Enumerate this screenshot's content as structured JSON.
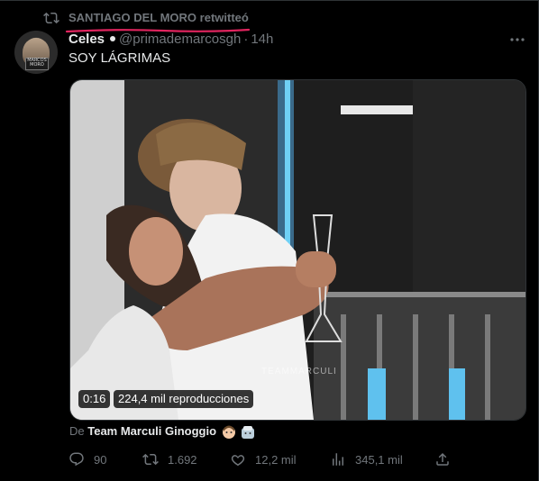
{
  "retweet": {
    "text": "SANTIAGO DEL MORO retwitteó",
    "icon": "retweet-icon"
  },
  "author": {
    "name": "Celes",
    "handle": "@primademarcosgh",
    "separator": "·",
    "time": "14h",
    "avatar_text": "MARCOS MORO"
  },
  "tweet": {
    "text": "SOY LÁGRIMAS"
  },
  "video": {
    "timer": "0:16",
    "views": "224,4 mil reproducciones",
    "watermark": "TEAMMARCULI"
  },
  "attribution": {
    "prefix": "De",
    "source": "Team Marculi Ginoggio"
  },
  "actions": {
    "replies": "90",
    "retweets": "1.692",
    "likes": "12,2 mil",
    "views": "345,1 mil"
  },
  "colors": {
    "background": "#000000",
    "text_primary": "#e7e9ea",
    "text_secondary": "#71767b",
    "underline": "#e0245e"
  }
}
